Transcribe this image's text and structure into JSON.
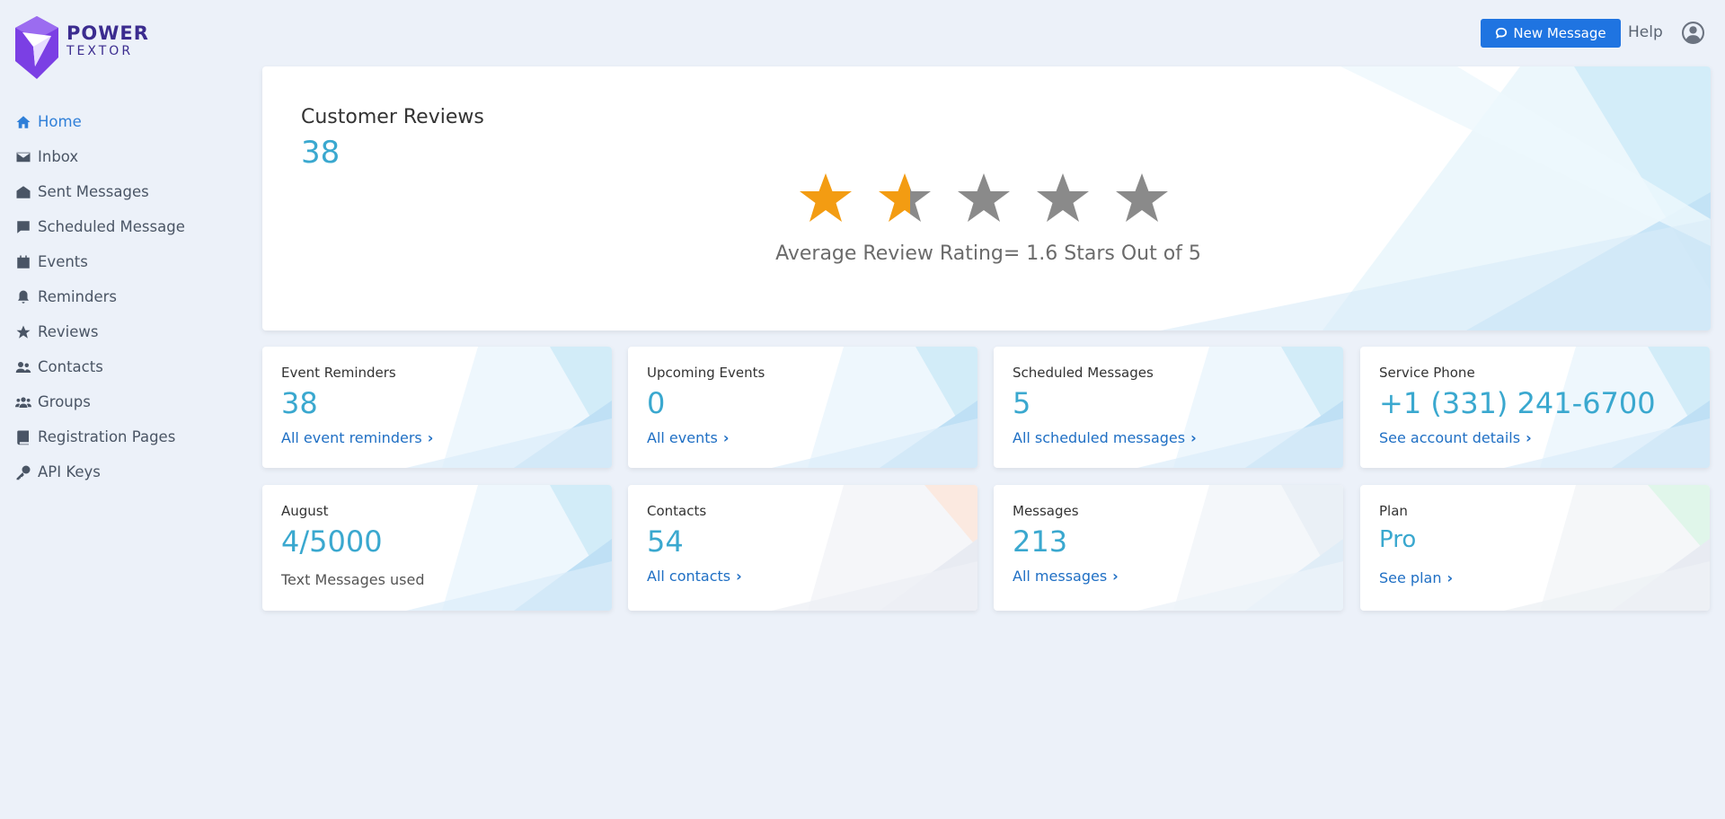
{
  "brand": {
    "line1": "POWER",
    "line2": "TEXTOR"
  },
  "sidebar": {
    "items": [
      {
        "label": "Home",
        "icon": "home-icon",
        "active": true
      },
      {
        "label": "Inbox",
        "icon": "envelope-icon"
      },
      {
        "label": "Sent Messages",
        "icon": "envelope-open-icon"
      },
      {
        "label": "Scheduled Message",
        "icon": "comment-icon"
      },
      {
        "label": "Events",
        "icon": "calendar-icon"
      },
      {
        "label": "Reminders",
        "icon": "bell-icon"
      },
      {
        "label": "Reviews",
        "icon": "star-icon"
      },
      {
        "label": "Contacts",
        "icon": "user-friends-icon"
      },
      {
        "label": "Groups",
        "icon": "users-icon"
      },
      {
        "label": "Registration Pages",
        "icon": "book-icon"
      },
      {
        "label": "API Keys",
        "icon": "key-icon"
      }
    ]
  },
  "header": {
    "new_message": "New Message",
    "help": "Help"
  },
  "reviews": {
    "title": "Customer Reviews",
    "count": "38",
    "rating": 1.6,
    "max_rating": 5,
    "average_text": "Average Review Rating= 1.6 Stars Out of 5",
    "star_color": "#f39c12",
    "empty_star_color": "#8a8a8a"
  },
  "stats": [
    {
      "label": "Event Reminders",
      "value": "38",
      "link": "All event reminders"
    },
    {
      "label": "Upcoming Events",
      "value": "0",
      "link": "All events"
    },
    {
      "label": "Scheduled Messages",
      "value": "5",
      "link": "All scheduled messages"
    },
    {
      "label": "Service Phone",
      "value": "+1 (331) 241-6700",
      "link": "See account details"
    },
    {
      "label": "August",
      "value": "4/5000",
      "sub": "Text Messages used"
    },
    {
      "label": "Contacts",
      "value": "54",
      "link": "All contacts"
    },
    {
      "label": "Messages",
      "value": "213",
      "link": "All messages"
    },
    {
      "label": "Plan",
      "value": "Pro",
      "link": "See plan"
    }
  ],
  "colors": {
    "accent": "#1f74e1",
    "value": "#3aa8cf",
    "link": "#1f6fc4",
    "brand": "#7b3fe4"
  }
}
